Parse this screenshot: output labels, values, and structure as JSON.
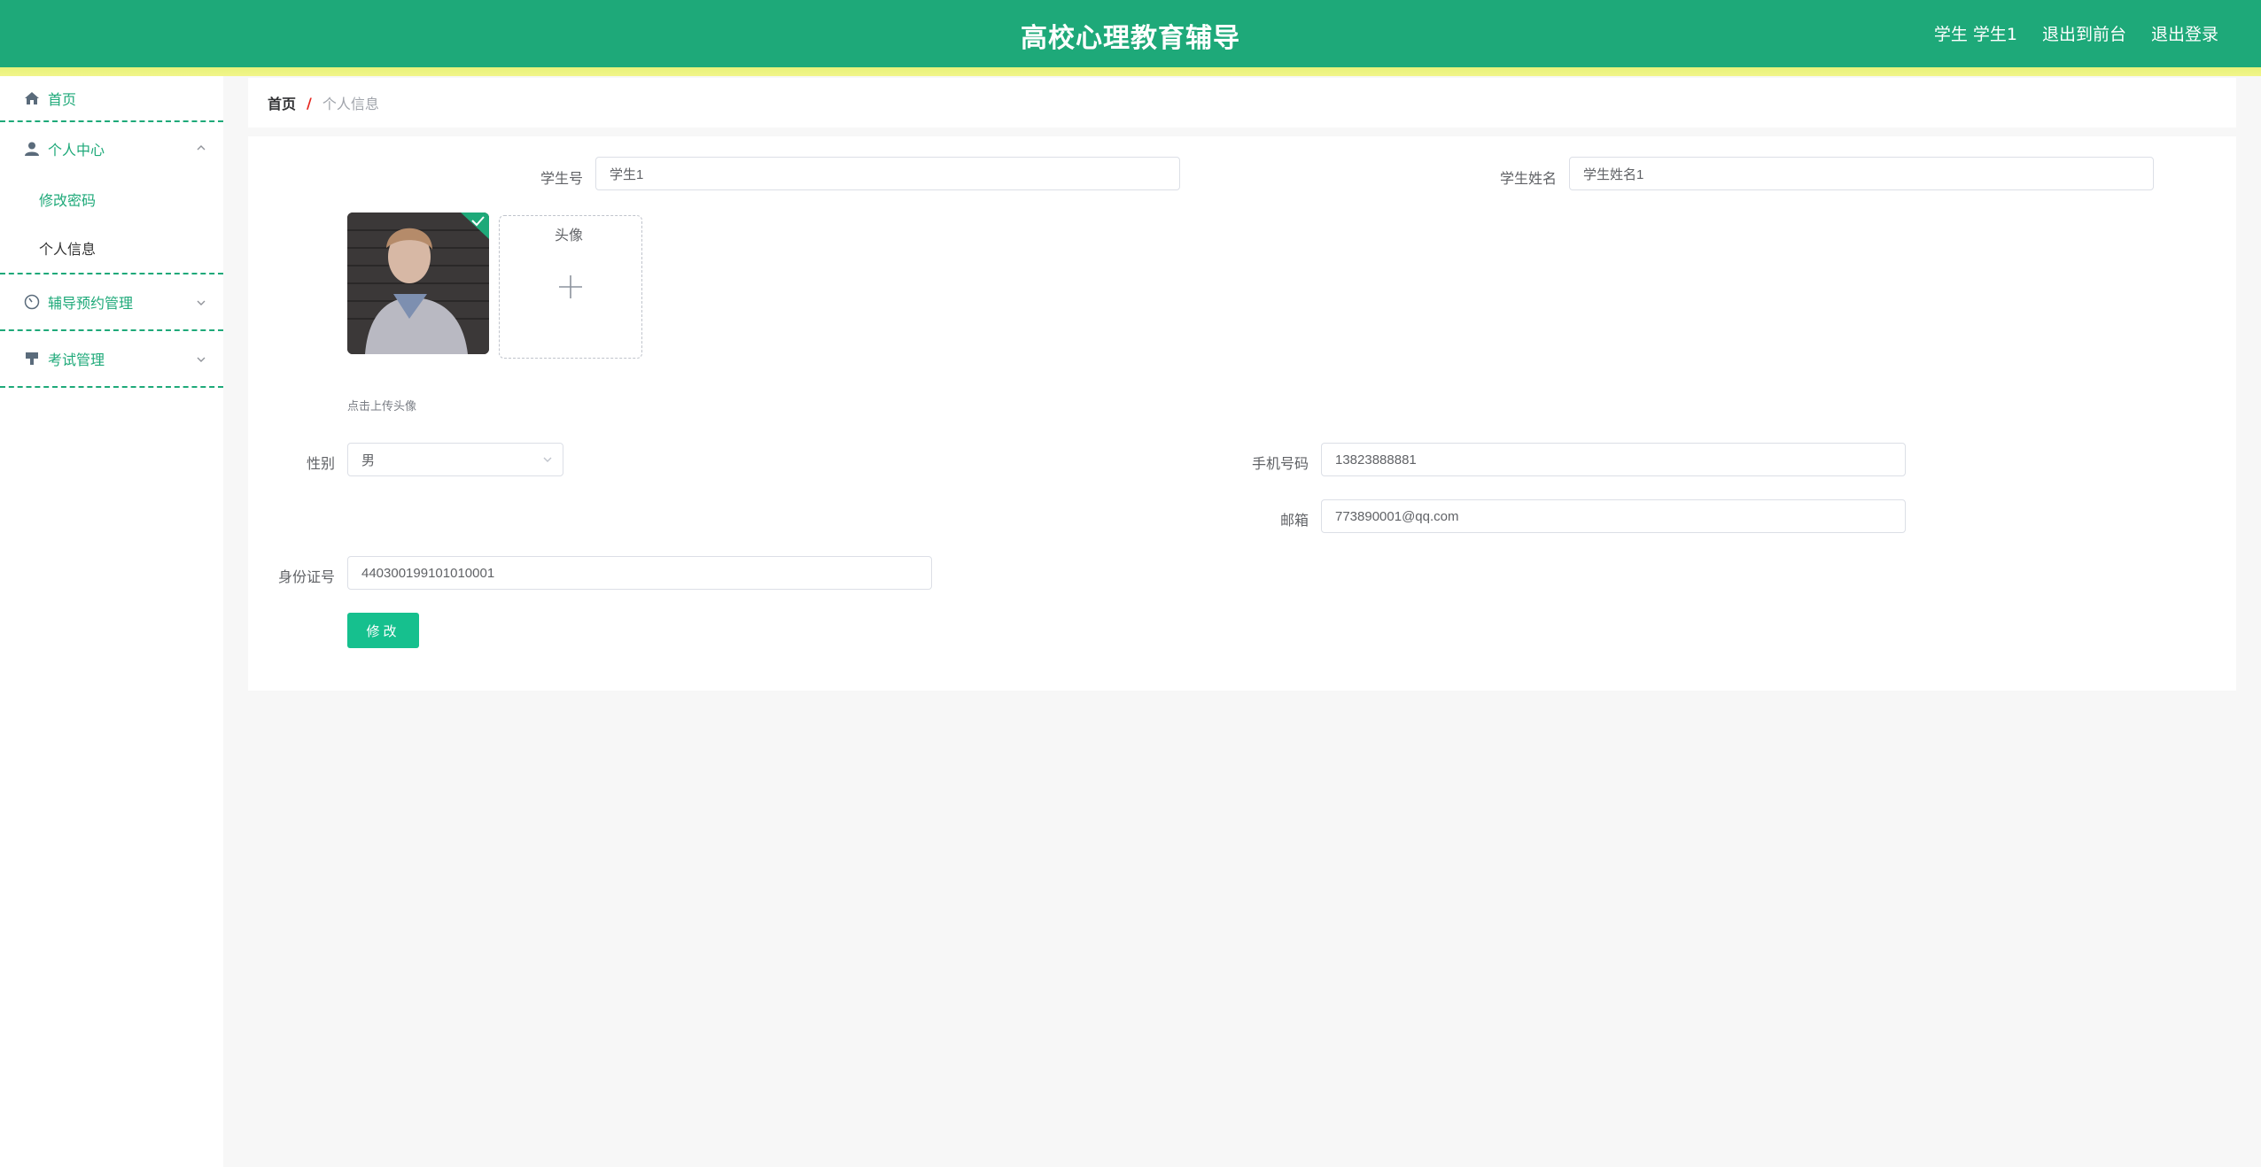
{
  "header": {
    "title": "高校心理教育辅导",
    "user": "学生 学生1",
    "back_to_front": "退出到前台",
    "logout": "退出登录"
  },
  "sidebar": {
    "home": "首页",
    "personal_center": "个人中心",
    "change_password": "修改密码",
    "personal_info": "个人信息",
    "counseling_mgmt": "辅导预约管理",
    "exam_mgmt": "考试管理"
  },
  "breadcrumb": {
    "home": "首页",
    "separator": "/",
    "current": "个人信息"
  },
  "form": {
    "student_no_label": "学生号",
    "student_no_value": "学生1",
    "student_name_label": "学生姓名",
    "student_name_value": "学生姓名1",
    "avatar_label": "头像",
    "avatar_tip": "点击上传头像",
    "gender_label": "性别",
    "gender_value": "男",
    "phone_label": "手机号码",
    "phone_value": "13823888881",
    "email_label": "邮箱",
    "email_value": "773890001@qq.com",
    "id_card_label": "身份证号",
    "id_card_value": "440300199101010001",
    "submit_label": "修改"
  },
  "colors": {
    "brand": "#1ea979",
    "header_strip": "#eef37f",
    "button": "#16c08e",
    "breadcrumb_separator": "#e6261f"
  }
}
